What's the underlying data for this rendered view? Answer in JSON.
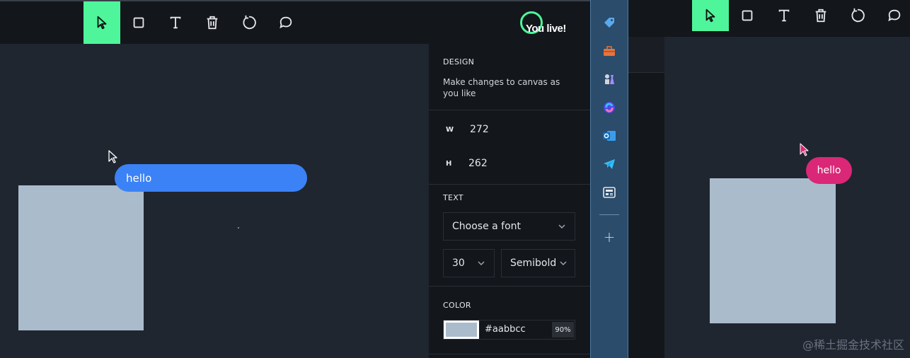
{
  "left_window": {
    "toolbar": {
      "tools": [
        {
          "name": "select",
          "icon": "cursor-icon",
          "active": true
        },
        {
          "name": "rectangle",
          "icon": "square-icon",
          "active": false
        },
        {
          "name": "text",
          "icon": "text-icon",
          "active": false
        },
        {
          "name": "delete",
          "icon": "trash-icon",
          "active": false
        },
        {
          "name": "reset",
          "icon": "refresh-icon",
          "active": false
        },
        {
          "name": "comment",
          "icon": "chat-bubble-icon",
          "active": false
        }
      ],
      "active_color": "#4ef59a",
      "avatar_text": "You live!"
    },
    "canvas": {
      "message_bubble": "hello",
      "bubble_color": "#3b82f6",
      "rect_color": "#aabbcc"
    }
  },
  "design_panel": {
    "title": "DESIGN",
    "description": "Make changes to canvas as you like",
    "width_label": "W",
    "width_value": "272",
    "height_label": "H",
    "height_value": "262",
    "text_section": "TEXT",
    "font_select": "Choose a font",
    "font_size": "30",
    "font_weight": "Semibold",
    "color_section": "COLOR",
    "color_hex": "#aabbcc",
    "color_opacity": "90%"
  },
  "edge_sidebar": {
    "icons": [
      "tag-icon",
      "toolbox-icon",
      "chess-icon",
      "copilot-icon",
      "outlook-icon",
      "telegram-icon",
      "news-icon"
    ],
    "add_label": "+",
    "bg_color": "#2b4c6b"
  },
  "right_window": {
    "toolbar": {
      "tools": [
        {
          "name": "select",
          "icon": "cursor-icon",
          "active": true
        },
        {
          "name": "rectangle",
          "icon": "square-icon",
          "active": false
        },
        {
          "name": "text",
          "icon": "text-icon",
          "active": false
        },
        {
          "name": "delete",
          "icon": "trash-icon",
          "active": false
        },
        {
          "name": "reset",
          "icon": "refresh-icon",
          "active": false
        },
        {
          "name": "comment",
          "icon": "chat-bubble-icon",
          "active": false
        }
      ]
    },
    "canvas": {
      "message_bubble": "hello",
      "bubble_color": "#db2777",
      "rect_color": "#aabbcc"
    }
  },
  "watermark": "@稀土掘金技术社区"
}
